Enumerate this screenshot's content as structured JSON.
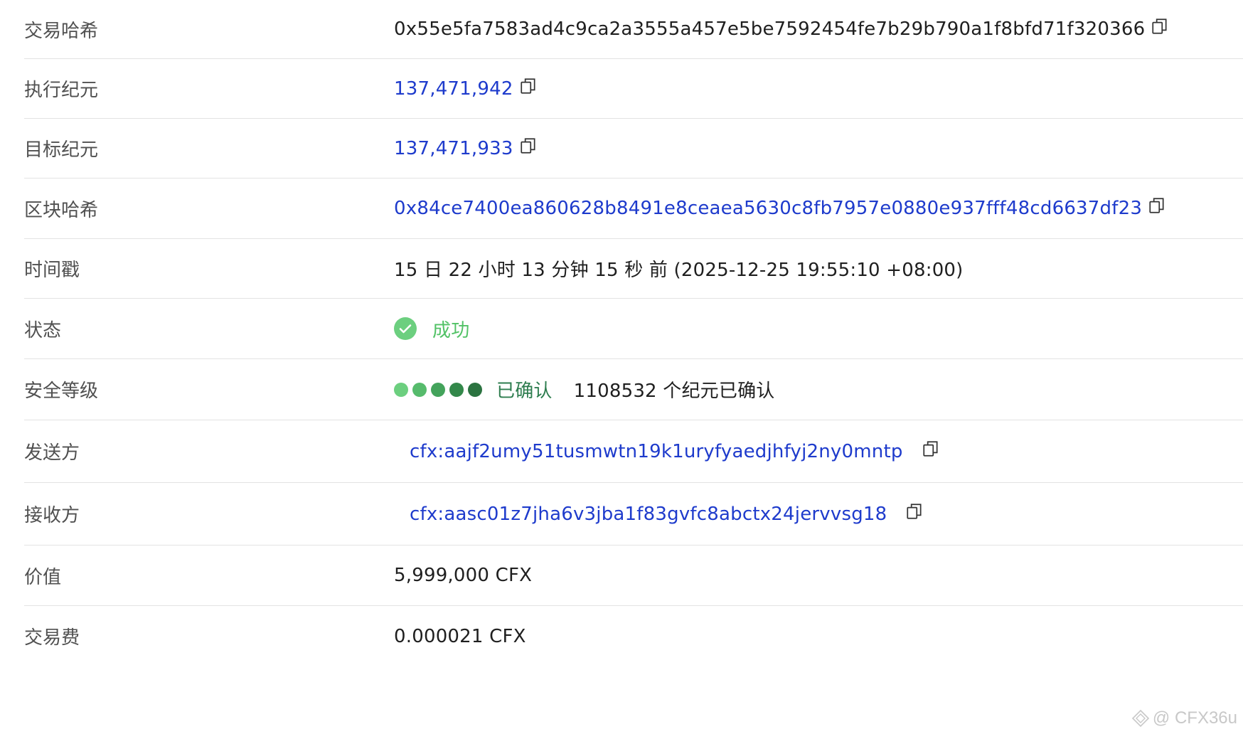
{
  "rows": {
    "tx_hash": {
      "label": "交易哈希",
      "value": "0x55e5fa7583ad4c9ca2a3555a457e5be7592454fe7b29b790a1f8bfd71f320366"
    },
    "executed_epoch": {
      "label": "执行纪元",
      "value": "137,471,942"
    },
    "target_epoch": {
      "label": "目标纪元",
      "value": "137,471,933"
    },
    "block_hash": {
      "label": "区块哈希",
      "value": "0x84ce7400ea860628b8491e8ceaea5630c8fb7957e0880e937fff48cd6637df23"
    },
    "timestamp": {
      "label": "时间戳",
      "value": "15 日 22 小时 13 分钟 15 秒 前 (2025-12-25 19:55:10 +08:00)"
    },
    "status": {
      "label": "状态",
      "value": "成功"
    },
    "security": {
      "label": "安全等级",
      "confirmed": "已确认",
      "detail": "1108532 个纪元已确认",
      "level": 5
    },
    "from": {
      "label": "发送方",
      "value": "cfx:aajf2umy51tusmwtn19k1uryfyaedjhfyj2ny0mntp"
    },
    "to": {
      "label": "接收方",
      "value": "cfx:aasc01z7jha6v3jba1f83gvfc8abctx24jervvsg18"
    },
    "value": {
      "label": "价值",
      "value": "5,999,000 CFX"
    },
    "fee": {
      "label": "交易费",
      "value": "0.000021 CFX"
    }
  },
  "watermark": {
    "text": "@ CFX36u",
    "icon": "watermark-logo-icon"
  },
  "colors": {
    "link": "#1e3bcc",
    "success": "#52c266",
    "confirmed": "#2e7d4f",
    "dots": [
      "#6ccf7f",
      "#56bb6c",
      "#43a35b",
      "#33884a",
      "#2b7340"
    ]
  }
}
